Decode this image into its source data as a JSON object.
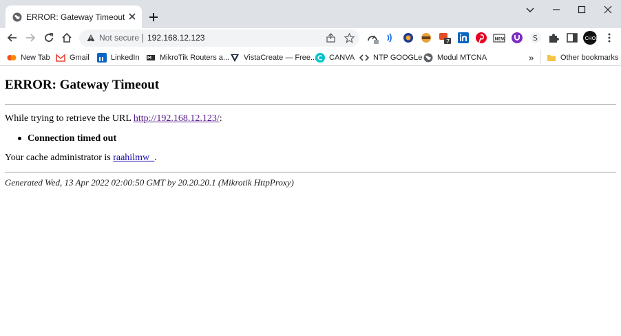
{
  "tab": {
    "title": "ERROR: Gateway Timeout"
  },
  "omnibox": {
    "security_label": "Not secure",
    "url": "192.168.12.123"
  },
  "bookmarks": [
    {
      "label": "New Tab",
      "icon": "new-tab-icon"
    },
    {
      "label": "Gmail",
      "icon": "gmail-icon"
    },
    {
      "label": "LinkedIn",
      "icon": "linkedin-icon"
    },
    {
      "label": "MikroTik Routers a...",
      "icon": "mikrotik-icon"
    },
    {
      "label": "VistaCreate — Free...",
      "icon": "vistacreate-icon"
    },
    {
      "label": "CANVA",
      "icon": "canva-icon"
    },
    {
      "label": "NTP GOOGLe",
      "icon": "ntp-icon"
    },
    {
      "label": "Modul MTCNA",
      "icon": "globe-icon"
    }
  ],
  "bookmarks_overflow": "»",
  "other_bookmarks": "Other bookmarks",
  "page": {
    "heading": "ERROR: Gateway Timeout",
    "retrieve_prefix": "While trying to retrieve the URL ",
    "retrieve_link": "http://192.168.12.123/",
    "retrieve_suffix": ":",
    "error_item": "Connection timed out",
    "admin_prefix": "Your cache administrator is ",
    "admin_link": "raahilmw_",
    "admin_suffix": ".",
    "footer": "Generated Wed, 13 Apr 2022 02:00:50 GMT by 20.20.20.1 (Mikrotik HttpProxy)"
  },
  "colors": {
    "tabstrip": "#dee1e6",
    "omnibox": "#f1f3f4",
    "visited_link": "#551a8b",
    "link": "#1a0dab"
  }
}
